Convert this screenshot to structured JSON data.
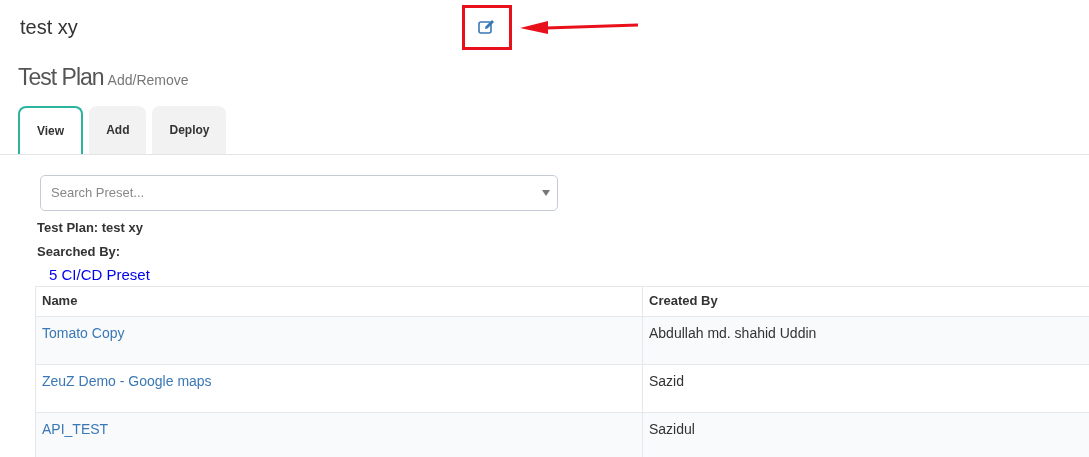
{
  "page_title": "test xy",
  "heading": {
    "title": "Test Plan",
    "subtitle": "Add/Remove"
  },
  "tabs": [
    {
      "label": "View",
      "selected": true
    },
    {
      "label": "Add",
      "selected": false
    },
    {
      "label": "Deploy",
      "selected": false
    }
  ],
  "search": {
    "placeholder": "Search Preset..."
  },
  "plan_label": "Test Plan: test xy",
  "searched_by_label": "Searched By:",
  "preset_link": "5 CI/CD Preset",
  "table": {
    "columns": [
      "Name",
      "Created By"
    ],
    "rows": [
      {
        "name": "Tomato Copy",
        "created_by": "Abdullah md. shahid Uddin"
      },
      {
        "name": "ZeuZ Demo - Google maps",
        "created_by": "Sazid"
      },
      {
        "name": "API_TEST",
        "created_by": "Sazidul"
      }
    ]
  }
}
